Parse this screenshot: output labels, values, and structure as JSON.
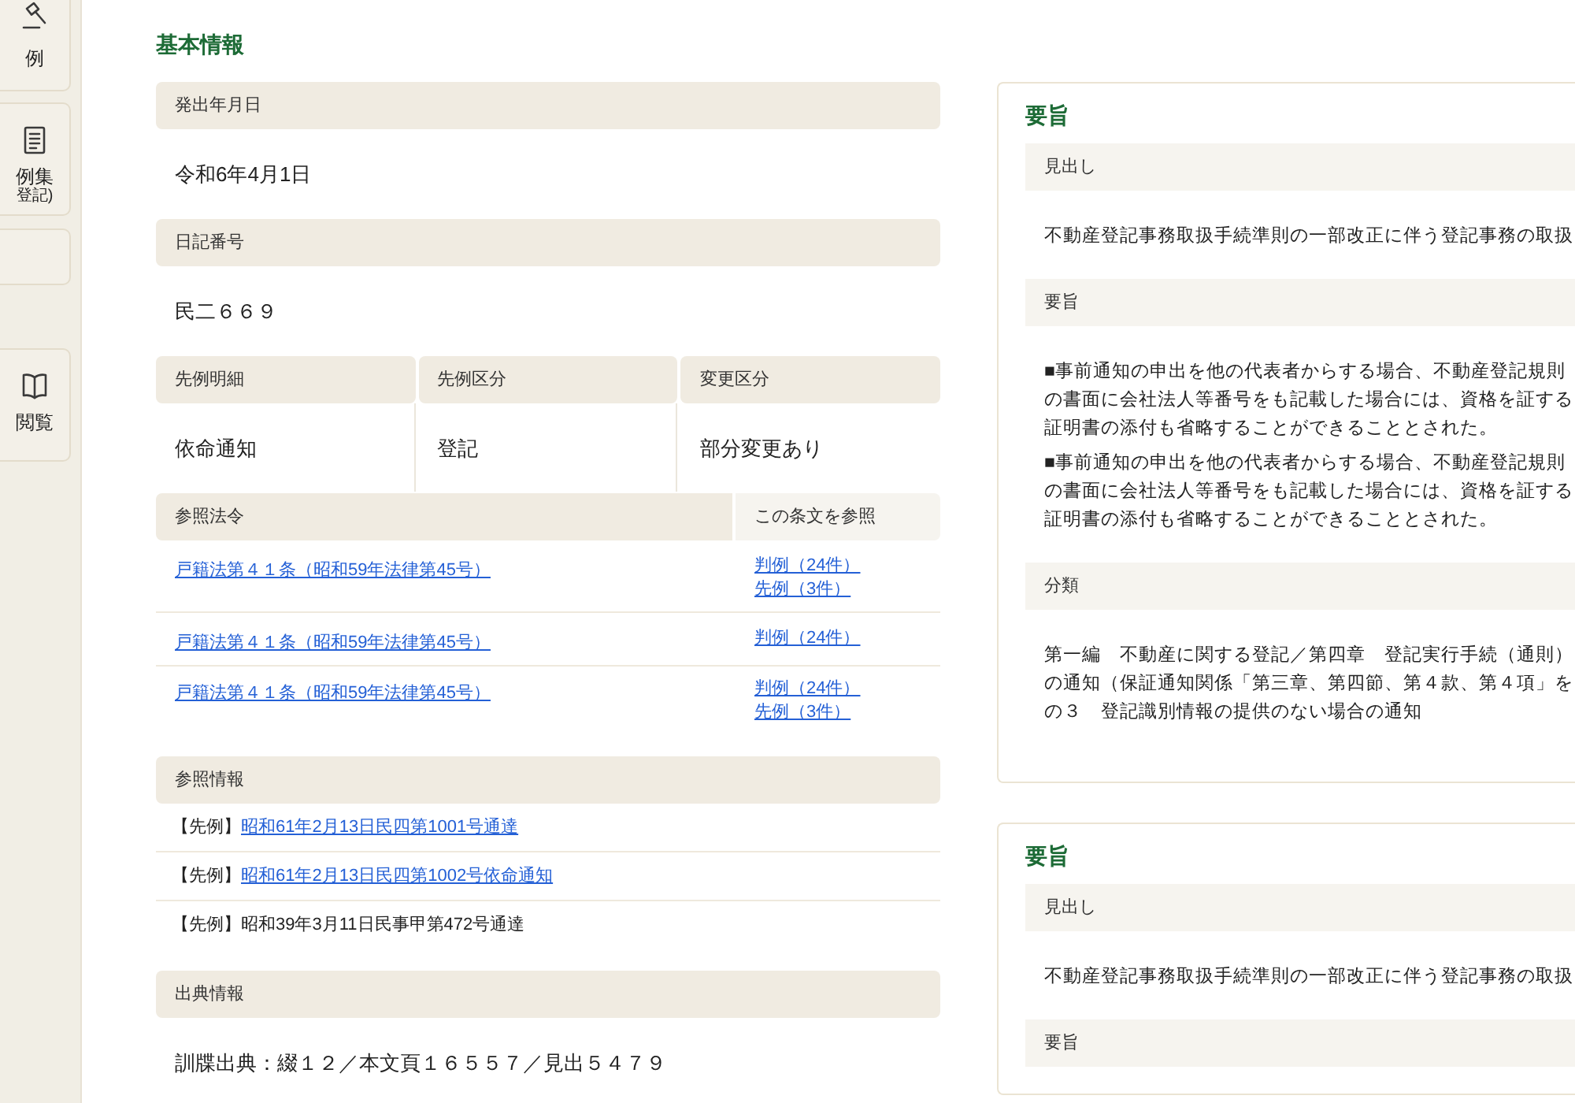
{
  "sidebar": {
    "items": [
      {
        "kind": "link",
        "label": "例"
      },
      {
        "kind": "link",
        "label": "例集",
        "sublabel": "登記)"
      },
      {
        "kind": "blank"
      },
      {
        "kind": "link",
        "label": "閲覧"
      }
    ]
  },
  "basic_info": {
    "title": "基本情報",
    "fields": [
      {
        "label": "発出年月日",
        "value": "令和6年4月1日"
      },
      {
        "label": "日記番号",
        "value": "民二６６９"
      }
    ],
    "details": [
      {
        "label": "先例明細",
        "value": "依命通知"
      },
      {
        "label": "先例区分",
        "value": "登記"
      },
      {
        "label": "変更区分",
        "value": "部分変更あり"
      }
    ],
    "laws": {
      "columns": [
        "参照法令",
        "この条文を参照"
      ],
      "rows": [
        {
          "law": "戸籍法第４１条（昭和59年法律第45号）",
          "references": [
            "判例（24件）",
            "先例（3件）"
          ]
        },
        {
          "law": "戸籍法第４１条（昭和59年法律第45号）",
          "references": [
            "判例（24件）"
          ]
        },
        {
          "law": "戸籍法第４１条（昭和59年法律第45号）",
          "references": [
            "判例（24件）",
            "先例（3件）"
          ]
        }
      ]
    },
    "reference_info": {
      "title": "参照情報",
      "items": [
        {
          "prefix": "【先例】",
          "text": "昭和61年2月13日民四第1001号通達",
          "linked": true
        },
        {
          "prefix": "【先例】",
          "text": "昭和61年2月13日民四第1002号依命通知",
          "linked": true
        },
        {
          "prefix": "【先例】",
          "text": "昭和39年3月11日民事甲第472号通達",
          "linked": false
        }
      ]
    },
    "source_info": {
      "title": "出典情報",
      "value": "訓牒出典：綴１２／本文頁１６５５７／見出５４７９"
    }
  },
  "summaries": [
    {
      "title": "要旨",
      "sections": [
        {
          "label": "見出し",
          "paragraphs": [
            [
              "不動産登記事務取扱手続準則の一部改正に伴う登記事務の取扱"
            ]
          ]
        },
        {
          "label": "要旨",
          "paragraphs": [
            [
              "■事前通知の申出を他の代表者からする場合、不動産登記規則",
              "の書面に会社法人等番号をも記載した場合には、資格を証する",
              "証明書の添付も省略することができることとされた。"
            ],
            [
              "■事前通知の申出を他の代表者からする場合、不動産登記規則",
              "の書面に会社法人等番号をも記載した場合には、資格を証する",
              "証明書の添付も省略することができることとされた。"
            ]
          ]
        },
        {
          "label": "分類",
          "paragraphs": [
            [
              "第一編　不動産に関する登記／第四章　登記実行手続（通則）",
              "の通知（保証通知関係「第三章、第四節、第４款、第４項」を",
              "の３　登記識別情報の提供のない場合の通知"
            ]
          ]
        }
      ]
    },
    {
      "title": "要旨",
      "sections": [
        {
          "label": "見出し",
          "paragraphs": [
            [
              "不動産登記事務取扱手続準則の一部改正に伴う登記事務の取扱"
            ]
          ]
        },
        {
          "label": "要旨"
        }
      ]
    }
  ]
}
